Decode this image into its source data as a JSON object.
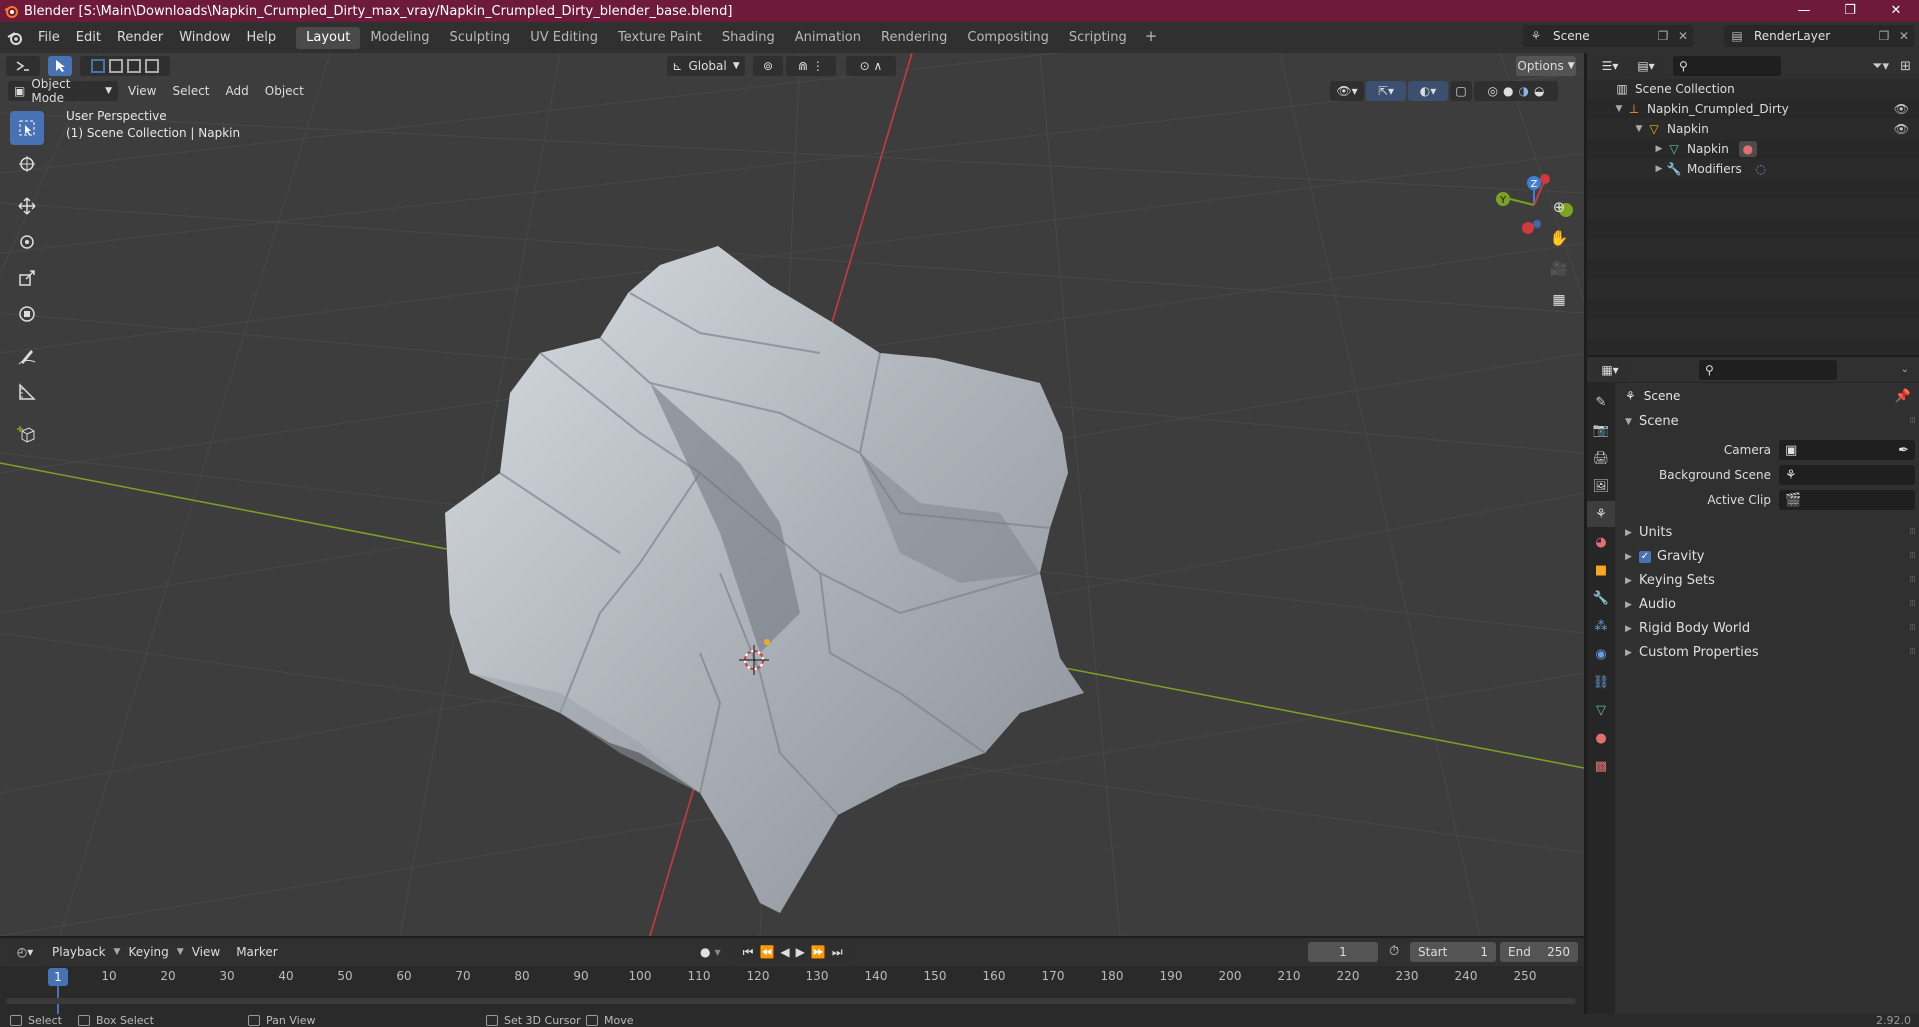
{
  "window": {
    "title": "Blender [S:\\Main\\Downloads\\Napkin_Crumpled_Dirty_max_vray/Napkin_Crumpled_Dirty_blender_base.blend]",
    "controls": [
      "—",
      "❐",
      "✕"
    ]
  },
  "menu": {
    "items": [
      "File",
      "Edit",
      "Render",
      "Window",
      "Help"
    ]
  },
  "workspaces": {
    "tabs": [
      "Layout",
      "Modeling",
      "Sculpting",
      "UV Editing",
      "Texture Paint",
      "Shading",
      "Animation",
      "Rendering",
      "Compositing",
      "Scripting"
    ],
    "active": "Layout",
    "add": "+"
  },
  "scene_selector": {
    "value": "Scene"
  },
  "layer_selector": {
    "value": "RenderLayer"
  },
  "viewport": {
    "orientation": "Global",
    "options_label": "Options",
    "mode": "Object Mode",
    "menus": [
      "View",
      "Select",
      "Add",
      "Object"
    ],
    "perspective": "User Perspective",
    "collection_info": "(1) Scene Collection | Napkin",
    "gizmo_axes": [
      "X",
      "Y",
      "Z"
    ]
  },
  "timeline": {
    "menus": [
      "Playback",
      "Keying",
      "View",
      "Marker"
    ],
    "current_frame": "1",
    "start_label": "Start",
    "start": "1",
    "end_label": "End",
    "end": "250",
    "ticks": [
      "10",
      "20",
      "30",
      "40",
      "50",
      "60",
      "70",
      "80",
      "90",
      "100",
      "110",
      "120",
      "130",
      "140",
      "150",
      "160",
      "170",
      "180",
      "190",
      "200",
      "210",
      "220",
      "230",
      "240",
      "250"
    ],
    "cursor_label": "1"
  },
  "statusbar": {
    "items": [
      "Select",
      "Box Select",
      "Pan View",
      "Set 3D Cursor",
      "Move"
    ],
    "version": "2.92.0"
  },
  "outliner": {
    "rows": [
      {
        "label": "Scene Collection",
        "icon": "collection-icon"
      },
      {
        "label": "Napkin_Crumpled_Dirty",
        "icon": "empty-icon"
      },
      {
        "label": "Napkin",
        "icon": "object-icon"
      },
      {
        "label": "Napkin",
        "icon": "mesh-icon"
      },
      {
        "label": "Modifiers",
        "icon": "wrench-icon"
      }
    ]
  },
  "properties": {
    "title": "Scene",
    "panel": "Scene",
    "fields": [
      {
        "label": "Camera",
        "value": ""
      },
      {
        "label": "Background Scene",
        "value": ""
      },
      {
        "label": "Active Clip",
        "value": ""
      }
    ],
    "sections": [
      "Units",
      "Gravity",
      "Keying Sets",
      "Audio",
      "Rigid Body World",
      "Custom Properties"
    ],
    "gravity_checked": true
  },
  "colors": {
    "titlebar": "#6e1a3a",
    "accent": "#4772b3",
    "x_axis": "#d03a3a",
    "y_axis": "#7ba321",
    "z_axis": "#3f7fd6"
  }
}
